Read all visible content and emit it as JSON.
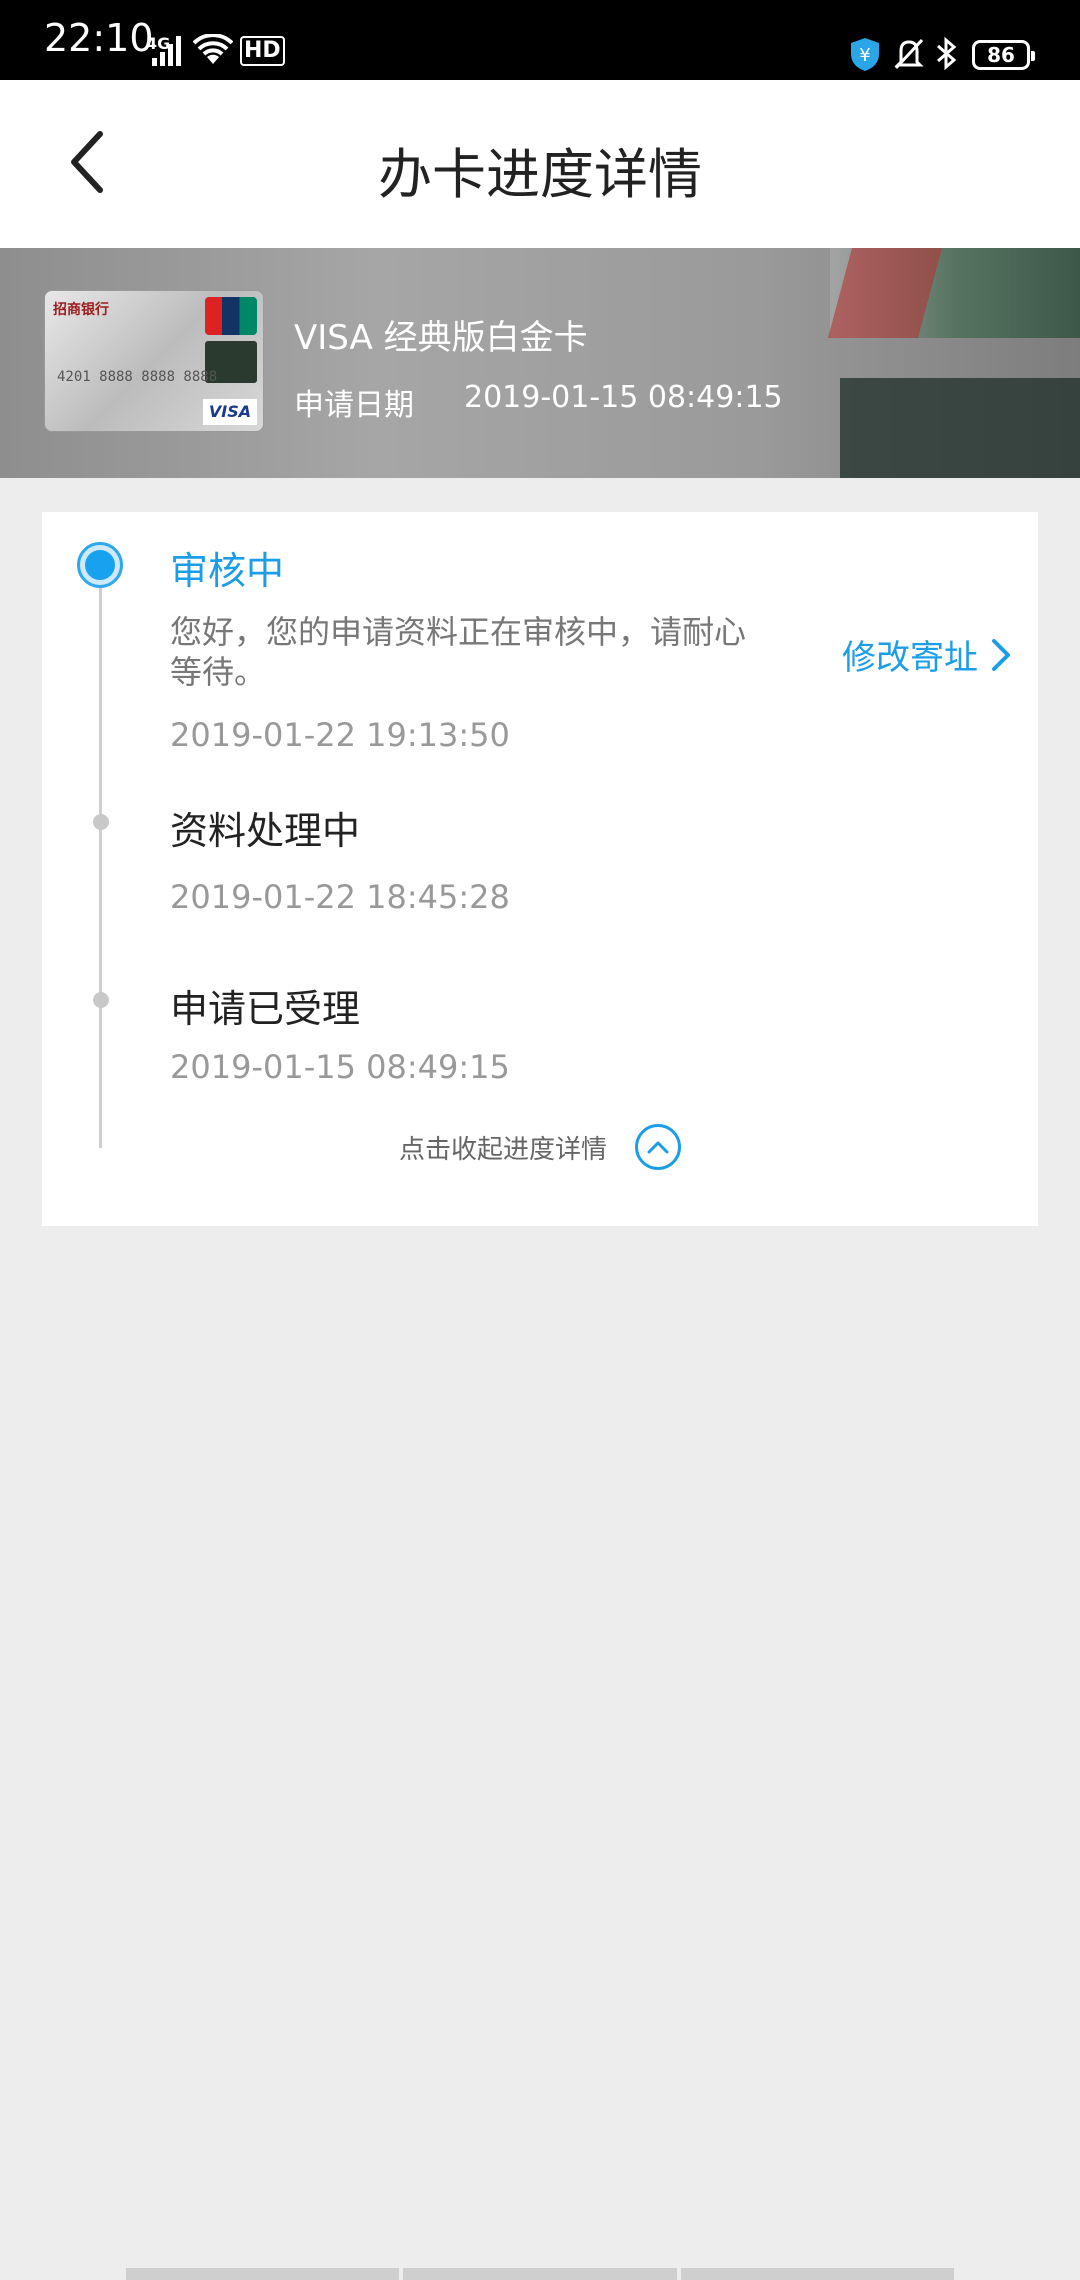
{
  "status_bar": {
    "time": "22:10",
    "network": "4G",
    "hd": "HD",
    "battery": "86"
  },
  "header": {
    "title": "办卡进度详情",
    "back_icon": "chevron-left-icon"
  },
  "card": {
    "name": "VISA 经典版白金卡",
    "apply_label": "申请日期",
    "apply_date": "2019-01-15 08:49:15",
    "thumb_bank": "招商银行",
    "thumb_number": "4201 8888 8888 8888",
    "thumb_brand": "VISA"
  },
  "progress": {
    "steps": [
      {
        "title": "审核中",
        "description": "您好，您的申请资料正在审核中，请耐心等待。",
        "time": "2019-01-22 19:13:50",
        "active": true
      },
      {
        "title": "资料处理中",
        "time": "2019-01-22 18:45:28",
        "active": false
      },
      {
        "title": "申请已受理",
        "time": "2019-01-15 08:49:15",
        "active": false
      }
    ],
    "modify_address_label": "修改寄址",
    "collapse_label": "点击收起进度详情"
  },
  "colors": {
    "accent": "#1c9ee6",
    "background": "#ededed",
    "status_bar": "#000000"
  }
}
